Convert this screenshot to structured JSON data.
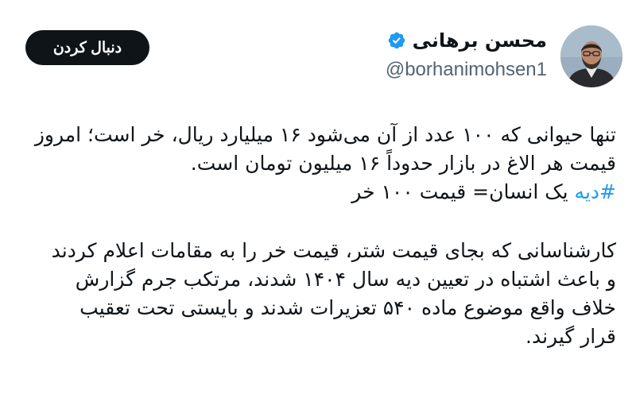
{
  "author": {
    "display_name": "محسن برهانی",
    "handle": "@borhanimohsen1",
    "verified": true,
    "verified_color": "#1d9bf0"
  },
  "follow_button": {
    "label": "دنبال کردن"
  },
  "tweet": {
    "line1": "تنها حیوانی که ۱۰۰ عدد از آن می‌شود ۱۶ میلیارد ریال، خر است؛ امروز",
    "line2": "قیمت هر الاغ در بازار حدوداً ۱۶ میلیون تومان است.",
    "hashtag": "#دیه",
    "line3_rest": " یک انسان= قیمت ۱۰۰ خر",
    "para2_line1": "کارشناسانی که بجای قیمت شتر، قیمت خر را به مقامات اعلام کردند",
    "para2_line2": "و باعث اشتباه در تعیین دیه سال ۱۴۰۴ شدند، مرتکب جرم گزارش",
    "para2_line3": "خلاف واقع موضوع ماده ۵۴۰ تعزیرات شدند و بایستی تحت تعقیب",
    "para2_line4": "قرار گیرند."
  },
  "colors": {
    "text": "#0f1419",
    "secondary": "#536471",
    "link": "#1d9bf0",
    "button_bg": "#0f1419"
  },
  "icons": {
    "verified": "verified-badge-icon",
    "avatar": "profile-photo"
  }
}
